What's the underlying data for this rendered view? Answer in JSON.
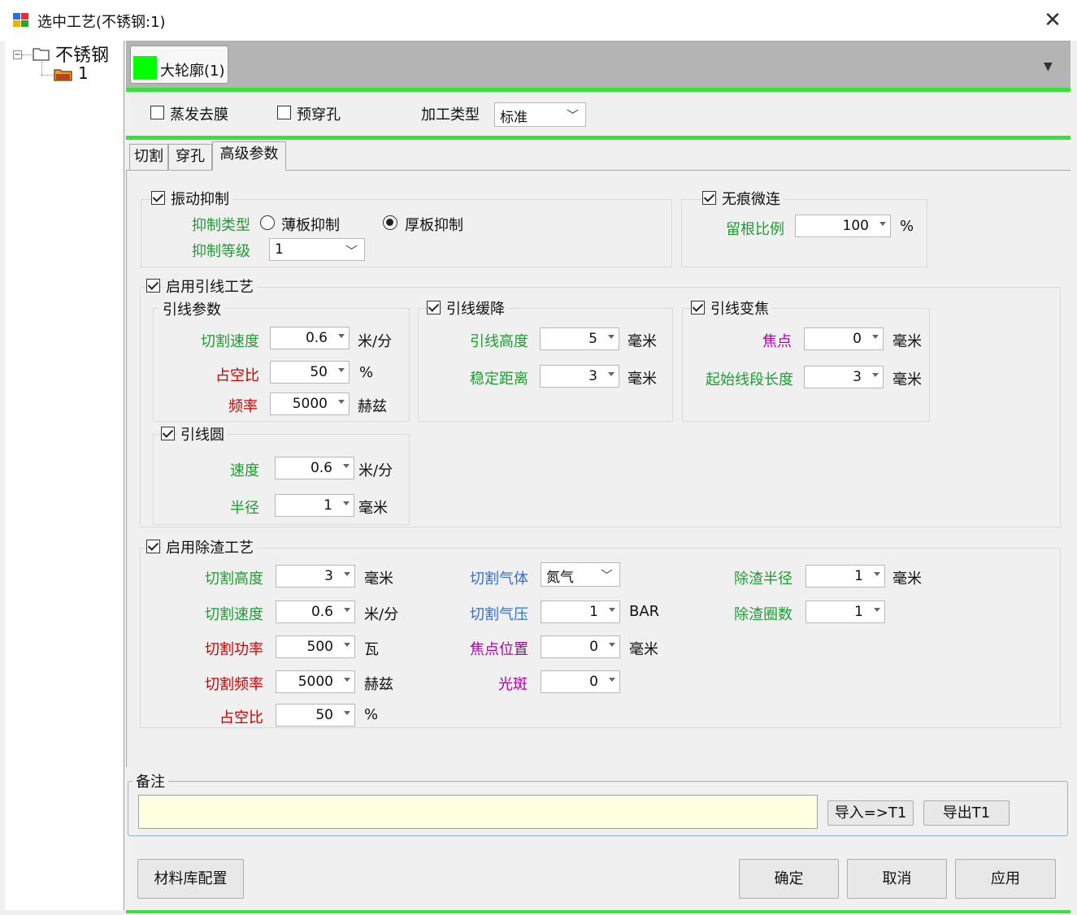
{
  "window": {
    "title": "选中工艺(不锈钢:1)",
    "close_glyph": "✕"
  },
  "tree": {
    "root": "不锈钢",
    "child": "1"
  },
  "main_tab": {
    "label": "大轮廓(1)",
    "color": "#00ff00"
  },
  "options": {
    "evaporate": "蒸发去膜",
    "pre_pierce": "预穿孔",
    "process_type_label": "加工类型",
    "process_type_value": "标准"
  },
  "tabs": [
    "切割",
    "穿孔",
    "高级参数"
  ],
  "vibration": {
    "title": "振动抑制",
    "type_label": "抑制类型",
    "thin": "薄板抑制",
    "thick": "厚板抑制",
    "level_label": "抑制等级",
    "level_value": "1"
  },
  "seamless": {
    "title": "无痕微连",
    "ratio_label": "留根比例",
    "ratio_value": "100",
    "ratio_unit": "%"
  },
  "leadin": {
    "title": "启用引线工艺",
    "params_title": "引线参数",
    "cut_speed_label": "切割速度",
    "cut_speed": "0.6",
    "cut_speed_unit": "米/分",
    "duty_label": "占空比",
    "duty": "50",
    "duty_unit": "%",
    "freq_label": "频率",
    "freq": "5000",
    "freq_unit": "赫兹",
    "slow_title": "引线缓降",
    "height_label": "引线高度",
    "height": "5",
    "height_unit": "毫米",
    "stable_label": "稳定距离",
    "stable": "3",
    "stable_unit": "毫米",
    "focus_title": "引线变焦",
    "focus_label": "焦点",
    "focus": "0",
    "focus_unit": "毫米",
    "start_len_label": "起始线段长度",
    "start_len": "3",
    "start_len_unit": "毫米",
    "circle_title": "引线圆",
    "speed_label": "速度",
    "speed": "0.6",
    "speed_unit": "米/分",
    "radius_label": "半径",
    "radius": "1",
    "radius_unit": "毫米"
  },
  "slag": {
    "title": "启用除渣工艺",
    "height_label": "切割高度",
    "height": "3",
    "height_unit": "毫米",
    "speed_label": "切割速度",
    "speed": "0.6",
    "speed_unit": "米/分",
    "power_label": "切割功率",
    "power": "500",
    "power_unit": "瓦",
    "freq_label": "切割频率",
    "freq": "5000",
    "freq_unit": "赫兹",
    "duty_label": "占空比",
    "duty": "50",
    "duty_unit": "%",
    "gas_label": "切割气体",
    "gas": "氮气",
    "pressure_label": "切割气压",
    "pressure": "1",
    "pressure_unit": "BAR",
    "focus_label": "焦点位置",
    "focus": "0",
    "focus_unit": "毫米",
    "spot_label": "光斑",
    "spot": "0",
    "slag_radius_label": "除渣半径",
    "slag_radius": "1",
    "slag_radius_unit": "毫米",
    "slag_turns_label": "除渣圈数",
    "slag_turns": "1"
  },
  "notes": {
    "title": "备注",
    "value": "",
    "import": "导入=>T1",
    "export": "导出T1"
  },
  "buttons": {
    "library": "材料库配置",
    "ok": "确定",
    "cancel": "取消",
    "apply": "应用"
  }
}
